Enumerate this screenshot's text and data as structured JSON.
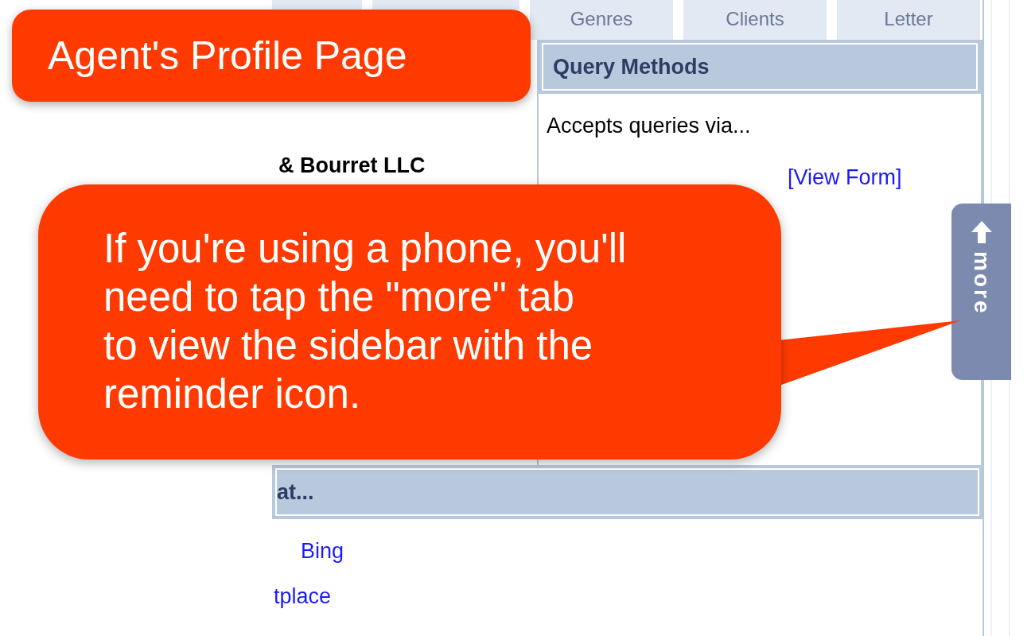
{
  "tabs": [
    {
      "label": "Genres"
    },
    {
      "label": "Clients"
    },
    {
      "label": "Letter"
    }
  ],
  "agency": "& Bourret LLC",
  "query_methods": {
    "title": "Query Methods",
    "intro": "Accepts queries via...",
    "link": "[View Form]"
  },
  "section_2": {
    "title": "at...",
    "links": [
      "Bing",
      "tplace"
    ]
  },
  "more_tab": {
    "label": "more"
  },
  "callouts": [
    {
      "lines": [
        "Agent's Profile Page"
      ]
    },
    {
      "lines": [
        "If you're using a phone, you'll",
        "need to tap the \"more\" tab",
        "to view the sidebar with the",
        "reminder icon."
      ]
    }
  ]
}
